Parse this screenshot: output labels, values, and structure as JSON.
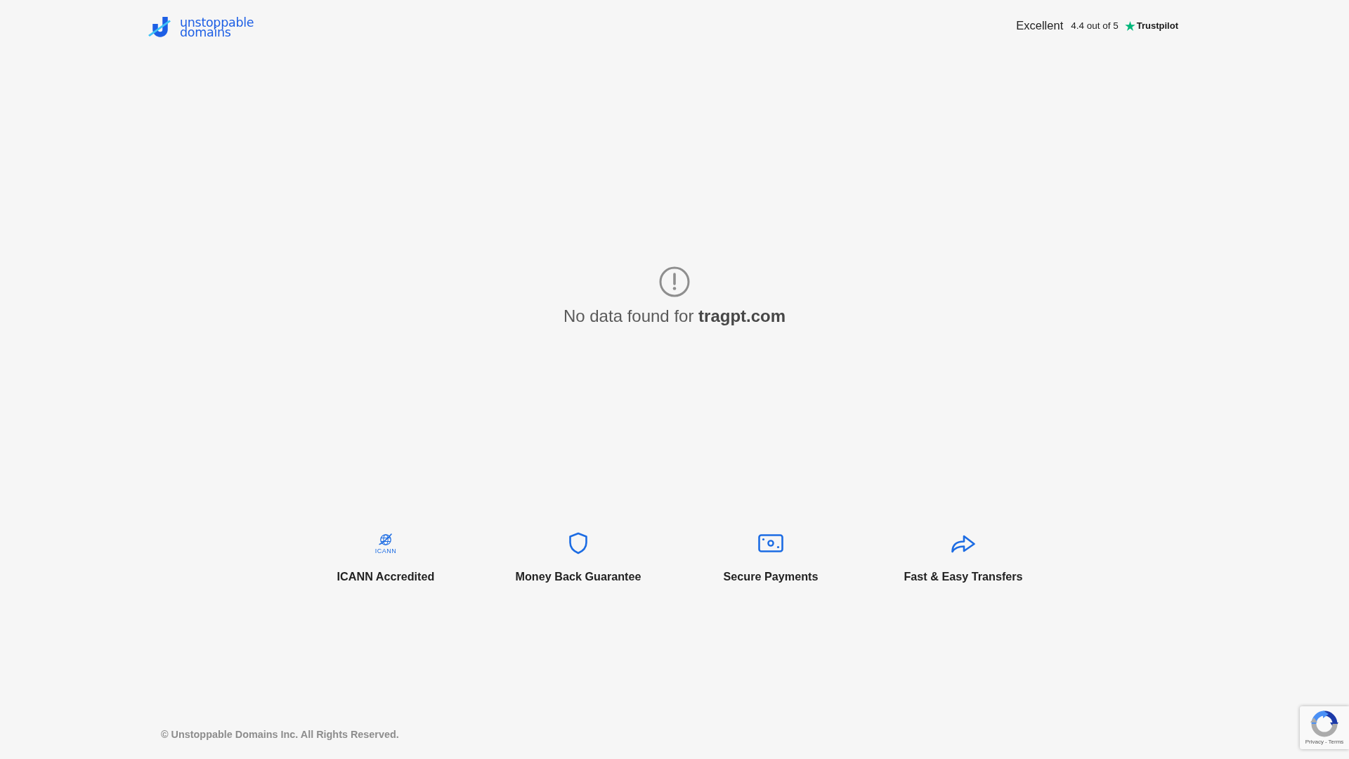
{
  "header": {
    "logo": {
      "lines": [
        "unstoppable",
        "domains"
      ]
    },
    "rating": {
      "label": "Excellent",
      "score": "4.4 out of 5",
      "brand": "Trustpilot"
    }
  },
  "message": {
    "text": "No data found for **tragpt.com**"
  },
  "features": [
    {
      "kind": "icann",
      "logo_text": "ICANN",
      "label": "ICANN Accredited"
    },
    {
      "kind": "shield",
      "label": "Money Back Guarantee"
    },
    {
      "kind": "cash",
      "label": "Secure Payments"
    },
    {
      "kind": "arrow",
      "label": "Fast & Easy Transfers"
    }
  ],
  "footer": {
    "copyright": "© Unstoppable Domains Inc. All Rights Reserved."
  },
  "recaptcha": {
    "links": [
      "Privacy",
      "Terms"
    ],
    "separator": "-"
  }
}
